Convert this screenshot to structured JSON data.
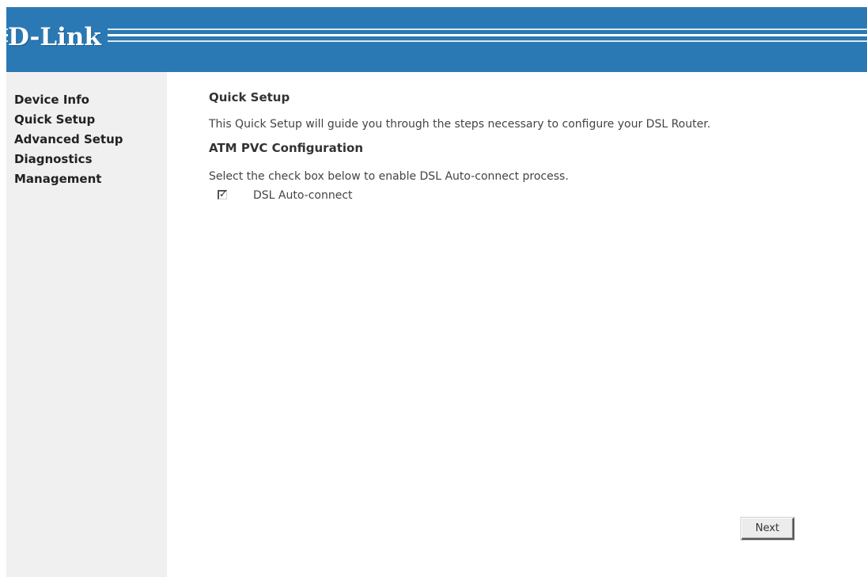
{
  "header": {
    "brand": "D-Link",
    "brand_color": "#2a79b5"
  },
  "sidebar": {
    "items": [
      {
        "label": "Device Info"
      },
      {
        "label": "Quick Setup"
      },
      {
        "label": "Advanced Setup"
      },
      {
        "label": "Diagnostics"
      },
      {
        "label": "Management"
      }
    ]
  },
  "main": {
    "title": "Quick Setup",
    "intro": "This Quick Setup will guide you through the steps necessary to configure your DSL Router.",
    "section_title": "ATM PVC Configuration",
    "instruction": "Select the check box below to enable DSL Auto-connect process.",
    "auto_connect": {
      "label": "DSL Auto-connect",
      "checked": true,
      "check_glyph": "✓"
    },
    "next_label": "Next"
  }
}
